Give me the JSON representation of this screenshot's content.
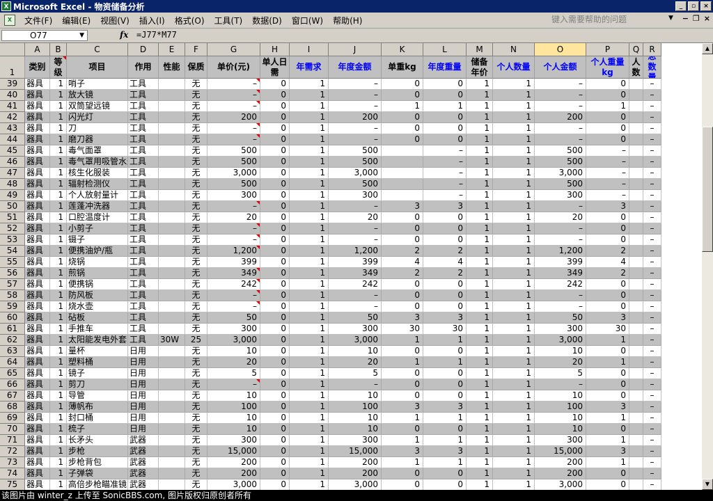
{
  "window": {
    "title": "Microsoft Excel - 物资储备分析",
    "app_icon": "excel-icon"
  },
  "menu": {
    "items": [
      "文件(F)",
      "编辑(E)",
      "视图(V)",
      "插入(I)",
      "格式(O)",
      "工具(T)",
      "数据(D)",
      "窗口(W)",
      "帮助(H)"
    ],
    "help_placeholder": "键入需要帮助的问题"
  },
  "formula_bar": {
    "name_box": "O77",
    "fx": "fx",
    "formula": "=J77*M77"
  },
  "columns": [
    "",
    "A",
    "B",
    "C",
    "D",
    "E",
    "F",
    "G",
    "H",
    "I",
    "J",
    "K",
    "L",
    "M",
    "N",
    "O",
    "P",
    "Q",
    "R"
  ],
  "header_row": {
    "row_number": "1",
    "cells": [
      "类别",
      "等级",
      "项目",
      "作用",
      "性能",
      "保质",
      "单价(元)",
      "单人日需",
      "年需求",
      "年度金额",
      "单重kg",
      "年度重量",
      "储备年价",
      "个人数量",
      "个人金额",
      "个人重量kg",
      "人数",
      "总数量"
    ]
  },
  "rows": [
    {
      "n": "39",
      "v": [
        "器具",
        "1",
        "哨子",
        "工具",
        "",
        "无",
        "–",
        "0",
        "1",
        "–",
        "0",
        "0",
        "1",
        "1",
        "–",
        "0",
        "",
        "–"
      ]
    },
    {
      "n": "40",
      "v": [
        "器具",
        "1",
        "放大镜",
        "工具",
        "",
        "无",
        "–",
        "0",
        "1",
        "–",
        "0",
        "0",
        "1",
        "1",
        "–",
        "0",
        "",
        "–"
      ]
    },
    {
      "n": "41",
      "v": [
        "器具",
        "1",
        "双筒望远镜",
        "工具",
        "",
        "无",
        "–",
        "0",
        "1",
        "–",
        "1",
        "1",
        "1",
        "1",
        "–",
        "1",
        "",
        "–"
      ]
    },
    {
      "n": "42",
      "v": [
        "器具",
        "1",
        "闪光灯",
        "工具",
        "",
        "无",
        "200",
        "0",
        "1",
        "200",
        "0",
        "0",
        "1",
        "1",
        "200",
        "0",
        "",
        "–"
      ]
    },
    {
      "n": "43",
      "v": [
        "器具",
        "1",
        "刀",
        "工具",
        "",
        "无",
        "–",
        "0",
        "1",
        "–",
        "0",
        "0",
        "1",
        "1",
        "–",
        "0",
        "",
        "–"
      ]
    },
    {
      "n": "44",
      "v": [
        "器具",
        "1",
        "磨刀器",
        "工具",
        "",
        "无",
        "–",
        "0",
        "1",
        "–",
        "0",
        "0",
        "1",
        "1",
        "–",
        "0",
        "",
        "–"
      ]
    },
    {
      "n": "45",
      "v": [
        "器具",
        "1",
        "毒气面罩",
        "工具",
        "",
        "无",
        "500",
        "0",
        "1",
        "500",
        "",
        "–",
        "1",
        "1",
        "500",
        "–",
        "",
        "–"
      ]
    },
    {
      "n": "46",
      "v": [
        "器具",
        "1",
        "毒气罩用吸管水壶",
        "工具",
        "",
        "无",
        "500",
        "0",
        "1",
        "500",
        "",
        "–",
        "1",
        "1",
        "500",
        "–",
        "",
        "–"
      ]
    },
    {
      "n": "47",
      "v": [
        "器具",
        "1",
        "核生化服装",
        "工具",
        "",
        "无",
        "3,000",
        "0",
        "1",
        "3,000",
        "",
        "–",
        "1",
        "1",
        "3,000",
        "–",
        "",
        "–"
      ]
    },
    {
      "n": "48",
      "v": [
        "器具",
        "1",
        "辐射检测仪",
        "工具",
        "",
        "无",
        "500",
        "0",
        "1",
        "500",
        "",
        "–",
        "1",
        "1",
        "500",
        "–",
        "",
        "–"
      ]
    },
    {
      "n": "49",
      "v": [
        "器具",
        "1",
        "个人放射量计",
        "工具",
        "",
        "无",
        "300",
        "0",
        "1",
        "300",
        "",
        "–",
        "1",
        "1",
        "300",
        "–",
        "",
        "–"
      ]
    },
    {
      "n": "50",
      "v": [
        "器具",
        "1",
        "莲蓬冲洗器",
        "工具",
        "",
        "无",
        "–",
        "0",
        "1",
        "–",
        "3",
        "3",
        "1",
        "1",
        "–",
        "3",
        "",
        "–"
      ]
    },
    {
      "n": "51",
      "v": [
        "器具",
        "1",
        "口腔温度计",
        "工具",
        "",
        "无",
        "20",
        "0",
        "1",
        "20",
        "0",
        "0",
        "1",
        "1",
        "20",
        "0",
        "",
        "–"
      ]
    },
    {
      "n": "52",
      "v": [
        "器具",
        "1",
        "小剪子",
        "工具",
        "",
        "无",
        "–",
        "0",
        "1",
        "–",
        "0",
        "0",
        "1",
        "1",
        "–",
        "0",
        "",
        "–"
      ]
    },
    {
      "n": "53",
      "v": [
        "器具",
        "1",
        "镊子",
        "工具",
        "",
        "无",
        "–",
        "0",
        "1",
        "–",
        "0",
        "0",
        "1",
        "1",
        "–",
        "0",
        "",
        "–"
      ]
    },
    {
      "n": "54",
      "v": [
        "器具",
        "1",
        "便携油炉/瓶",
        "工具",
        "",
        "无",
        "1,200",
        "0",
        "1",
        "1,200",
        "2",
        "2",
        "1",
        "1",
        "1,200",
        "2",
        "",
        "–"
      ]
    },
    {
      "n": "55",
      "v": [
        "器具",
        "1",
        "烧锅",
        "工具",
        "",
        "无",
        "399",
        "0",
        "1",
        "399",
        "4",
        "4",
        "1",
        "1",
        "399",
        "4",
        "",
        "–"
      ]
    },
    {
      "n": "56",
      "v": [
        "器具",
        "1",
        "煎锅",
        "工具",
        "",
        "无",
        "349",
        "0",
        "1",
        "349",
        "2",
        "2",
        "1",
        "1",
        "349",
        "2",
        "",
        "–"
      ]
    },
    {
      "n": "57",
      "v": [
        "器具",
        "1",
        "便携锅",
        "工具",
        "",
        "无",
        "242",
        "0",
        "1",
        "242",
        "0",
        "0",
        "1",
        "1",
        "242",
        "0",
        "",
        "–"
      ]
    },
    {
      "n": "58",
      "v": [
        "器具",
        "1",
        "防风板",
        "工具",
        "",
        "无",
        "–",
        "0",
        "1",
        "–",
        "0",
        "0",
        "1",
        "1",
        "–",
        "0",
        "",
        "–"
      ]
    },
    {
      "n": "59",
      "v": [
        "器具",
        "1",
        "烧水壶",
        "工具",
        "",
        "无",
        "–",
        "0",
        "1",
        "–",
        "0",
        "0",
        "1",
        "1",
        "–",
        "0",
        "",
        "–"
      ]
    },
    {
      "n": "60",
      "v": [
        "器具",
        "1",
        "砧板",
        "工具",
        "",
        "无",
        "50",
        "0",
        "1",
        "50",
        "3",
        "3",
        "1",
        "1",
        "50",
        "3",
        "",
        "–"
      ]
    },
    {
      "n": "61",
      "v": [
        "器具",
        "1",
        "手推车",
        "工具",
        "",
        "无",
        "300",
        "0",
        "1",
        "300",
        "30",
        "30",
        "1",
        "1",
        "300",
        "30",
        "",
        "–"
      ]
    },
    {
      "n": "62",
      "v": [
        "器具",
        "1",
        "太阳能发电外套",
        "工具",
        "30W",
        "25",
        "3,000",
        "0",
        "1",
        "3,000",
        "1",
        "1",
        "1",
        "1",
        "3,000",
        "1",
        "",
        "–"
      ]
    },
    {
      "n": "63",
      "v": [
        "器具",
        "1",
        "量杯",
        "日用",
        "",
        "无",
        "10",
        "0",
        "1",
        "10",
        "0",
        "0",
        "1",
        "1",
        "10",
        "0",
        "",
        "–"
      ]
    },
    {
      "n": "64",
      "v": [
        "器具",
        "1",
        "塑料桶",
        "日用",
        "",
        "无",
        "20",
        "0",
        "1",
        "20",
        "1",
        "1",
        "1",
        "1",
        "20",
        "1",
        "",
        "–"
      ]
    },
    {
      "n": "65",
      "v": [
        "器具",
        "1",
        "镜子",
        "日用",
        "",
        "无",
        "5",
        "0",
        "1",
        "5",
        "0",
        "0",
        "1",
        "1",
        "5",
        "0",
        "",
        "–"
      ]
    },
    {
      "n": "66",
      "v": [
        "器具",
        "1",
        "剪刀",
        "日用",
        "",
        "无",
        "–",
        "0",
        "1",
        "–",
        "0",
        "0",
        "1",
        "1",
        "–",
        "0",
        "",
        "–"
      ]
    },
    {
      "n": "67",
      "v": [
        "器具",
        "1",
        "导管",
        "日用",
        "",
        "无",
        "10",
        "0",
        "1",
        "10",
        "0",
        "0",
        "1",
        "1",
        "10",
        "0",
        "",
        "–"
      ]
    },
    {
      "n": "68",
      "v": [
        "器具",
        "1",
        "薄帆布",
        "日用",
        "",
        "无",
        "100",
        "0",
        "1",
        "100",
        "3",
        "3",
        "1",
        "1",
        "100",
        "3",
        "",
        "–"
      ]
    },
    {
      "n": "69",
      "v": [
        "器具",
        "1",
        "封口桶",
        "日用",
        "",
        "无",
        "10",
        "0",
        "1",
        "10",
        "1",
        "1",
        "1",
        "1",
        "10",
        "1",
        "",
        "–"
      ]
    },
    {
      "n": "70",
      "v": [
        "器具",
        "1",
        "梳子",
        "日用",
        "",
        "无",
        "10",
        "0",
        "1",
        "10",
        "0",
        "0",
        "1",
        "1",
        "10",
        "0",
        "",
        "–"
      ]
    },
    {
      "n": "71",
      "v": [
        "器具",
        "1",
        "长矛头",
        "武器",
        "",
        "无",
        "300",
        "0",
        "1",
        "300",
        "1",
        "1",
        "1",
        "1",
        "300",
        "1",
        "",
        "–"
      ]
    },
    {
      "n": "72",
      "v": [
        "器具",
        "1",
        "步枪",
        "武器",
        "",
        "无",
        "15,000",
        "0",
        "1",
        "15,000",
        "3",
        "3",
        "1",
        "1",
        "15,000",
        "3",
        "",
        "–"
      ]
    },
    {
      "n": "73",
      "v": [
        "器具",
        "1",
        "步枪背包",
        "武器",
        "",
        "无",
        "200",
        "0",
        "1",
        "200",
        "1",
        "1",
        "1",
        "1",
        "200",
        "1",
        "",
        "–"
      ]
    },
    {
      "n": "74",
      "v": [
        "器具",
        "1",
        "子弹袋",
        "武器",
        "",
        "无",
        "200",
        "0",
        "1",
        "200",
        "0",
        "0",
        "1",
        "1",
        "200",
        "0",
        "",
        "–"
      ]
    },
    {
      "n": "75",
      "v": [
        "器具",
        "1",
        "高倍步枪瞄准镜",
        "武器",
        "",
        "无",
        "3,000",
        "0",
        "1",
        "3,000",
        "0",
        "0",
        "1",
        "1",
        "3,000",
        "0",
        "",
        "–"
      ]
    }
  ],
  "status": {
    "text": "该图片由 winter_z 上传至 SonicBBS.com, 图片版权归原创者所有"
  }
}
